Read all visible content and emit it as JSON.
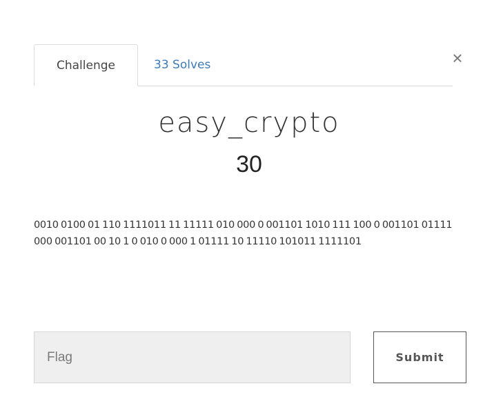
{
  "tabs": [
    {
      "label": "Challenge",
      "active": true
    },
    {
      "label": "33 Solves",
      "active": false
    }
  ],
  "close_label": "×",
  "challenge": {
    "title": "easy_crypto",
    "points": "30",
    "description": "0010 0100 01 110 1111011 11 11111 010 000 0 001101 1010 111 100 0 001101 01111 000 001101 00 10 1 0 010 0 000 1 01111 10 11110 101011 1111101"
  },
  "form": {
    "flag_placeholder": "Flag",
    "flag_value": "",
    "submit_label": "Submit"
  },
  "colors": {
    "link": "#3d7ab8",
    "border": "#dcdcdc",
    "input_bg": "#efefef"
  }
}
